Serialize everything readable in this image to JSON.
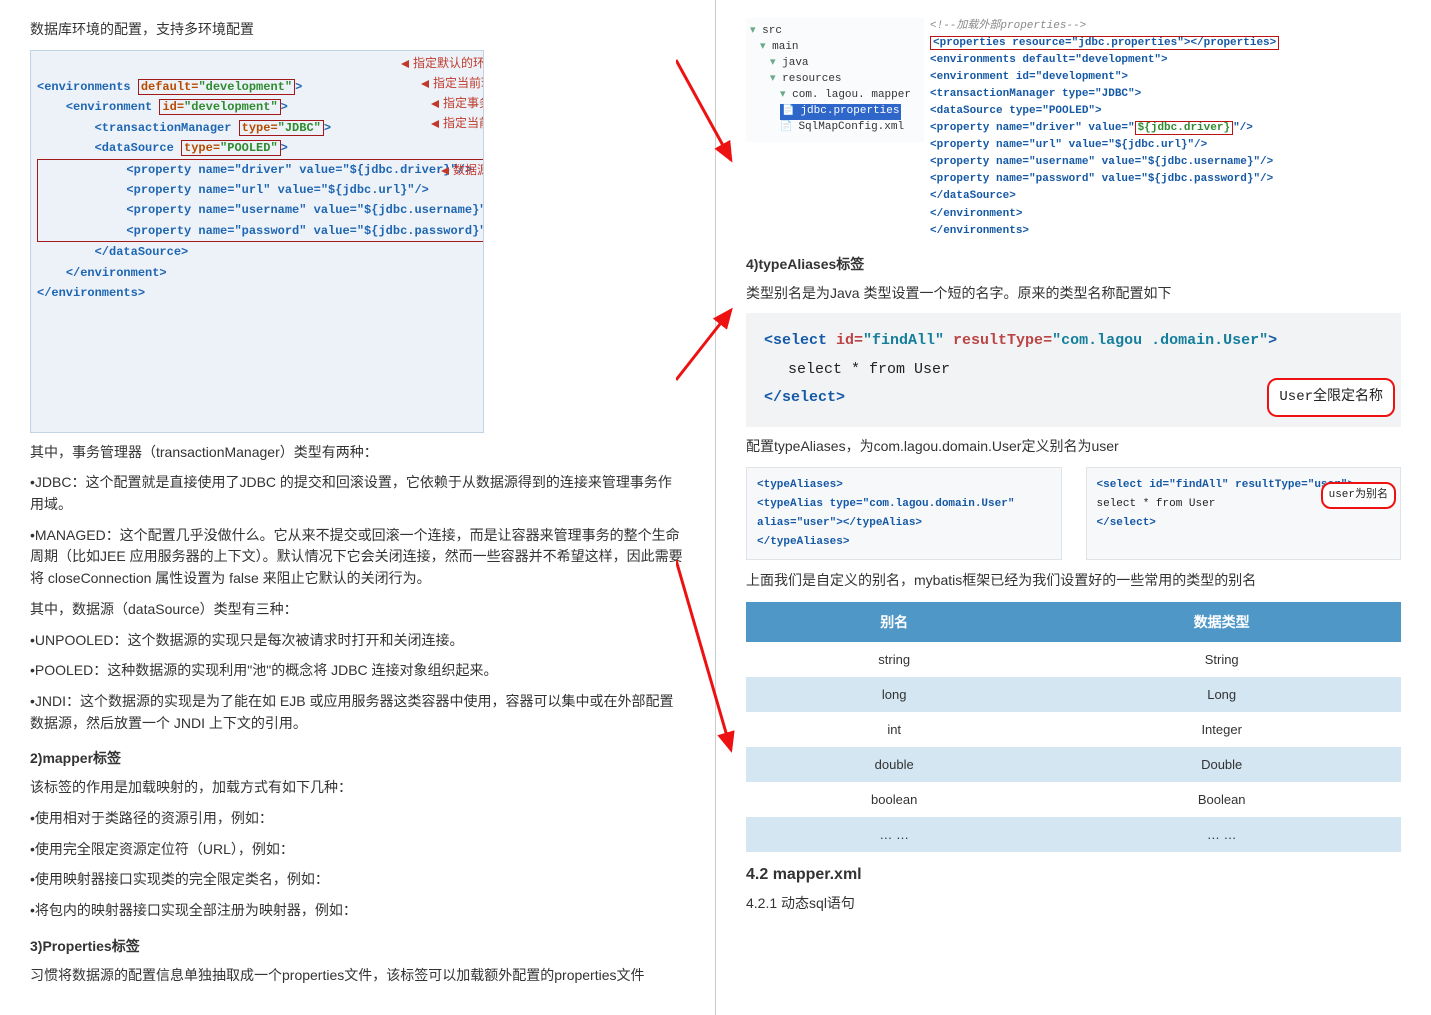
{
  "left": {
    "intro": "数据库环境的配置，支持多环境配置",
    "code": {
      "env_open_a": "<environments ",
      "env_default_attr": "default=",
      "env_default_val": "\"development\"",
      "env_open_b": ">",
      "env2_open_a": "<environment ",
      "env2_id_attr": "id=",
      "env2_id_val": "\"development\"",
      "env2_open_b": ">",
      "tm_open_a": "<transactionManager ",
      "tm_type_attr": "type=",
      "tm_type_val": "\"JDBC\"",
      "tm_close": ">",
      "ds_open_a": "<dataSource ",
      "ds_type_attr": "type=",
      "ds_type_val": "\"POOLED\"",
      "ds_open_b": ">",
      "p_driver": "<property name=\"driver\" value=\"${jdbc.driver}\"/>",
      "p_url": "<property name=\"url\" value=\"${jdbc.url}\"/>",
      "p_user": "<property name=\"username\" value=\"${jdbc.username}\"/>",
      "p_pass": "<property name=\"password\" value=\"${jdbc.password}\"/>",
      "ds_close": "</dataSource>",
      "env2_close": "</environment>",
      "env_close": "</environments>",
      "callout1": "指定默认的环境名称",
      "callout2": "指定当前环境的名称",
      "callout3": "指定事务管理类型是JDBC",
      "callout4": "指定当前数据源类型是连接池",
      "callout5": "数据源配置的基本参数"
    },
    "para1": "其中，事务管理器（transactionManager）类型有两种：",
    "para2": "•JDBC：这个配置就是直接使用了JDBC 的提交和回滚设置，它依赖于从数据源得到的连接来管理事务作用域。",
    "para3": "•MANAGED：这个配置几乎没做什么。它从来不提交或回滚一个连接，而是让容器来管理事务的整个生命周期（比如JEE 应用服务器的上下文）。默认情况下它会关闭连接，然而一些容器并不希望这样，因此需要将 closeConnection 属性设置为 false 来阻止它默认的关闭行为。",
    "para4": "其中，数据源（dataSource）类型有三种：",
    "para5": "•UNPOOLED：这个数据源的实现只是每次被请求时打开和关闭连接。",
    "para6": "•POOLED：这种数据源的实现利用\"池\"的概念将 JDBC 连接对象组织起来。",
    "para7": "•JNDI：这个数据源的实现是为了能在如 EJB 或应用服务器这类容器中使用，容器可以集中或在外部配置数据源，然后放置一个 JNDI 上下文的引用。",
    "h2": "2)mapper标签",
    "para8": "该标签的作用是加载映射的，加载方式有如下几种：",
    "para9": "•使用相对于类路径的资源引用，例如：",
    "para10": "•使用完全限定资源定位符（URL），例如：",
    "para11": "•使用映射器接口实现类的完全限定类名，例如：",
    "para12": "•将包内的映射器接口实现全部注册为映射器，例如：",
    "h3": "3)Properties标签",
    "para13": "习惯将数据源的配置信息单独抽取成一个properties文件，该标签可以加载额外配置的properties文件"
  },
  "right": {
    "topcode": {
      "comment": "<!--加载外部properties-->",
      "props": "<properties resource=\"jdbc.properties\"></properties>",
      "l1": "<environments default=\"development\">",
      "l2": "  <environment id=\"development\">",
      "l3": "    <transactionManager type=\"JDBC\">",
      "l4": "    <dataSource type=\"POOLED\">",
      "l5a": "      <property name=\"driver\" value=\"",
      "l5b": "${jdbc.driver}",
      "l5c": "\"/>",
      "l6": "      <property name=\"url\" value=\"${jdbc.url}\"/>",
      "l7": "      <property name=\"username\" value=\"${jdbc.username}\"/>",
      "l8": "      <property name=\"password\" value=\"${jdbc.password}\"/>",
      "l9": "    </dataSource>",
      "l10": "  </environment>",
      "l11": "</environments>"
    },
    "tree": {
      "t1": "src",
      "t2": "main",
      "t3": "java",
      "t4": "resources",
      "t5": "com. lagou. mapper",
      "t6": "jdbc.properties",
      "t7": "SqlMapConfig.xml"
    },
    "h4": "4)typeAliases标签",
    "para_ta": "类型别名是为Java 类型设置一个短的名字。原来的类型名称配置如下",
    "select": {
      "open": "<select",
      "id_a": " id=",
      "id_v": "\"findAll\"",
      "rt_a": " resultType=",
      "rt_v": "\"com.lagou .domain.User\"",
      "close": ">",
      "body": "select * from User",
      "end": "</select>",
      "note": "User全限定名称"
    },
    "para_cfg": "配置typeAliases，为com.lagou.domain.User定义别名为user",
    "miniA": {
      "l1": "<typeAliases>",
      "l2": "  <typeAlias type=\"com.lagou.domain.User\" alias=\"user\"></typeAlias>",
      "l3": "</typeAliases>"
    },
    "miniB": {
      "l1": "<select id=\"findAll\" resultType=\"user\">",
      "l2": "  select * from User",
      "l3": "</select>",
      "note": "user为别名"
    },
    "para_builtin": "上面我们是自定义的别名，mybatis框架已经为我们设置好的一些常用的类型的别名",
    "table": {
      "h1": "别名",
      "h2": "数据类型",
      "rows": [
        [
          "string",
          "String"
        ],
        [
          "long",
          "Long"
        ],
        [
          "int",
          "Integer"
        ],
        [
          "double",
          "Double"
        ],
        [
          "boolean",
          "Boolean"
        ],
        [
          "… …",
          "… …"
        ]
      ]
    },
    "h42": "4.2 mapper.xml",
    "h421": "4.2.1 动态sql语句"
  }
}
